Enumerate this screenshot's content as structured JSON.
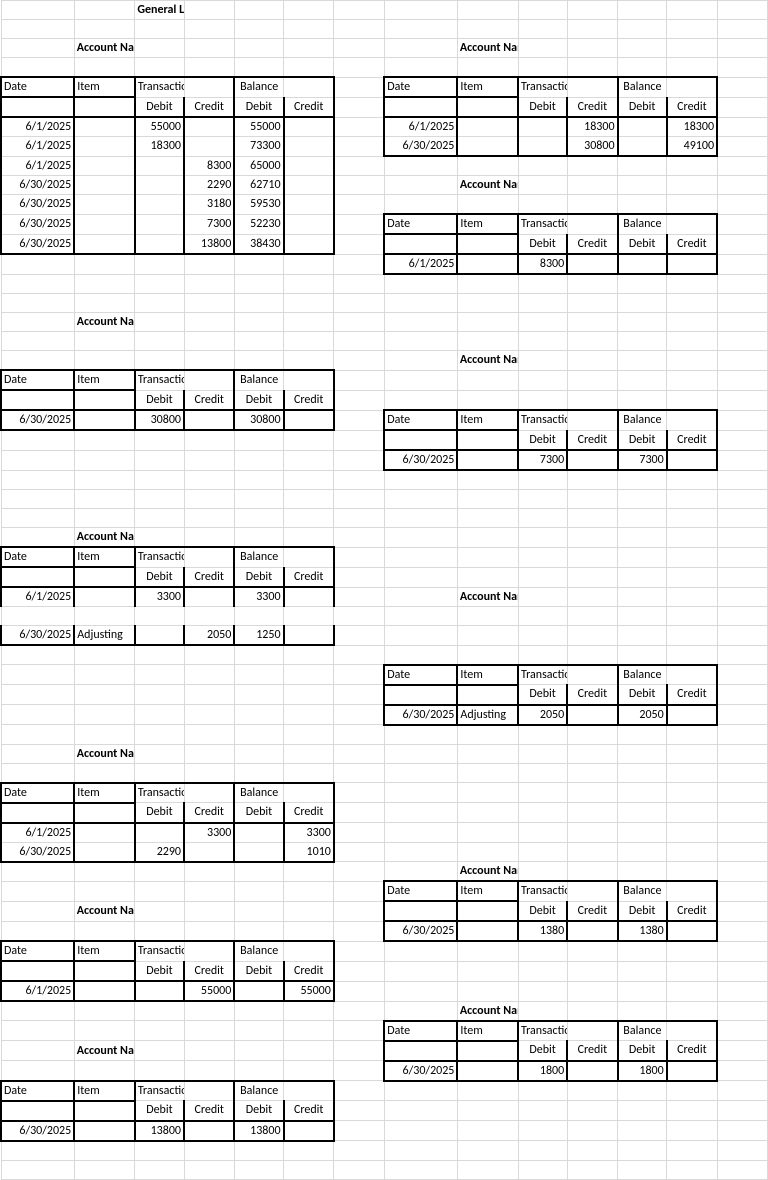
{
  "title": "General Ledger",
  "labels": {
    "date": "Date",
    "item": "Item",
    "transaction": "Transaction",
    "balance": "Balance",
    "debit": "Debit",
    "credit": "Credit",
    "adjusting": "Adjusting"
  },
  "accounts": {
    "cash": {
      "name": "Account Name: Cash",
      "rows": [
        {
          "date": "6/1/2025",
          "d": "55000",
          "c": "",
          "bd": "55000",
          "bc": ""
        },
        {
          "date": "6/1/2025",
          "d": "18300",
          "c": "",
          "bd": "73300",
          "bc": ""
        },
        {
          "date": "6/1/2025",
          "d": "",
          "c": "8300",
          "bd": "65000",
          "bc": ""
        },
        {
          "date": "6/30/2025",
          "d": "",
          "c": "2290",
          "bd": "62710",
          "bc": ""
        },
        {
          "date": "6/30/2025",
          "d": "",
          "c": "3180",
          "bd": "59530",
          "bc": ""
        },
        {
          "date": "6/30/2025",
          "d": "",
          "c": "7300",
          "bd": "52230",
          "bc": ""
        },
        {
          "date": "6/30/2025",
          "d": "",
          "c": "13800",
          "bd": "38430",
          "bc": ""
        }
      ]
    },
    "ar": {
      "name": "Account Name: Accounts Receivable",
      "rows": [
        {
          "date": "6/30/2025",
          "d": "30800",
          "c": "",
          "bd": "30800",
          "bc": ""
        }
      ]
    },
    "supplies": {
      "name": "Account Name: Supplies",
      "rows": [
        {
          "date": "6/1/2025",
          "item": "",
          "d": "3300",
          "c": "",
          "bd": "3300",
          "bc": ""
        },
        {
          "date": "6/30/2025",
          "item": "Adjusting",
          "d": "",
          "c": "2050",
          "bd": "1250",
          "bc": ""
        }
      ]
    },
    "ap": {
      "name": "Account Name: Accounts Payable",
      "rows": [
        {
          "date": "6/1/2025",
          "d": "",
          "c": "3300",
          "bd": "",
          "bc": "3300"
        },
        {
          "date": "6/30/2025",
          "d": "2290",
          "c": "",
          "bd": "",
          "bc": "1010"
        }
      ]
    },
    "capital": {
      "name": "Account Name: Joe Smith, Capital",
      "rows": [
        {
          "date": "6/1/2025",
          "d": "",
          "c": "55000",
          "bd": "",
          "bc": "55000"
        }
      ]
    },
    "drawing": {
      "name": "Account Name: Joe Smith, Drawing",
      "rows": [
        {
          "date": "6/30/2025",
          "d": "13800",
          "c": "",
          "bd": "13800",
          "bc": ""
        }
      ]
    },
    "fees": {
      "name": "Account Name: Fees Earned",
      "rows": [
        {
          "date": "6/1/2025",
          "d": "",
          "c": "18300",
          "bd": "",
          "bc": "18300"
        },
        {
          "date": "6/30/2025",
          "d": "",
          "c": "30800",
          "bd": "",
          "bc": "49100"
        }
      ]
    },
    "rent": {
      "name": "Account Name: Rent Expense",
      "rows": [
        {
          "date": "6/1/2025",
          "d": "8300",
          "c": "",
          "bd": "",
          "bc": ""
        }
      ]
    },
    "salaries": {
      "name": "Account Name: Salaries Expense",
      "rows": [
        {
          "date": "6/30/2025",
          "d": "7300",
          "c": "",
          "bd": "7300",
          "bc": ""
        }
      ]
    },
    "supx": {
      "name": "Account Name: Supplies Expense",
      "rows": [
        {
          "date": "6/30/2025",
          "item": "Adjusting",
          "d": "2050",
          "c": "",
          "bd": "2050",
          "bc": ""
        }
      ]
    },
    "auto": {
      "name": "Account Name: Auto Expense",
      "rows": [
        {
          "date": "6/30/2025",
          "d": "1380",
          "c": "",
          "bd": "1380",
          "bc": ""
        }
      ]
    },
    "misc": {
      "name": "Account Name: Misc. Expense",
      "rows": [
        {
          "date": "6/30/2025",
          "d": "1800",
          "c": "",
          "bd": "1800",
          "bc": ""
        }
      ]
    }
  }
}
